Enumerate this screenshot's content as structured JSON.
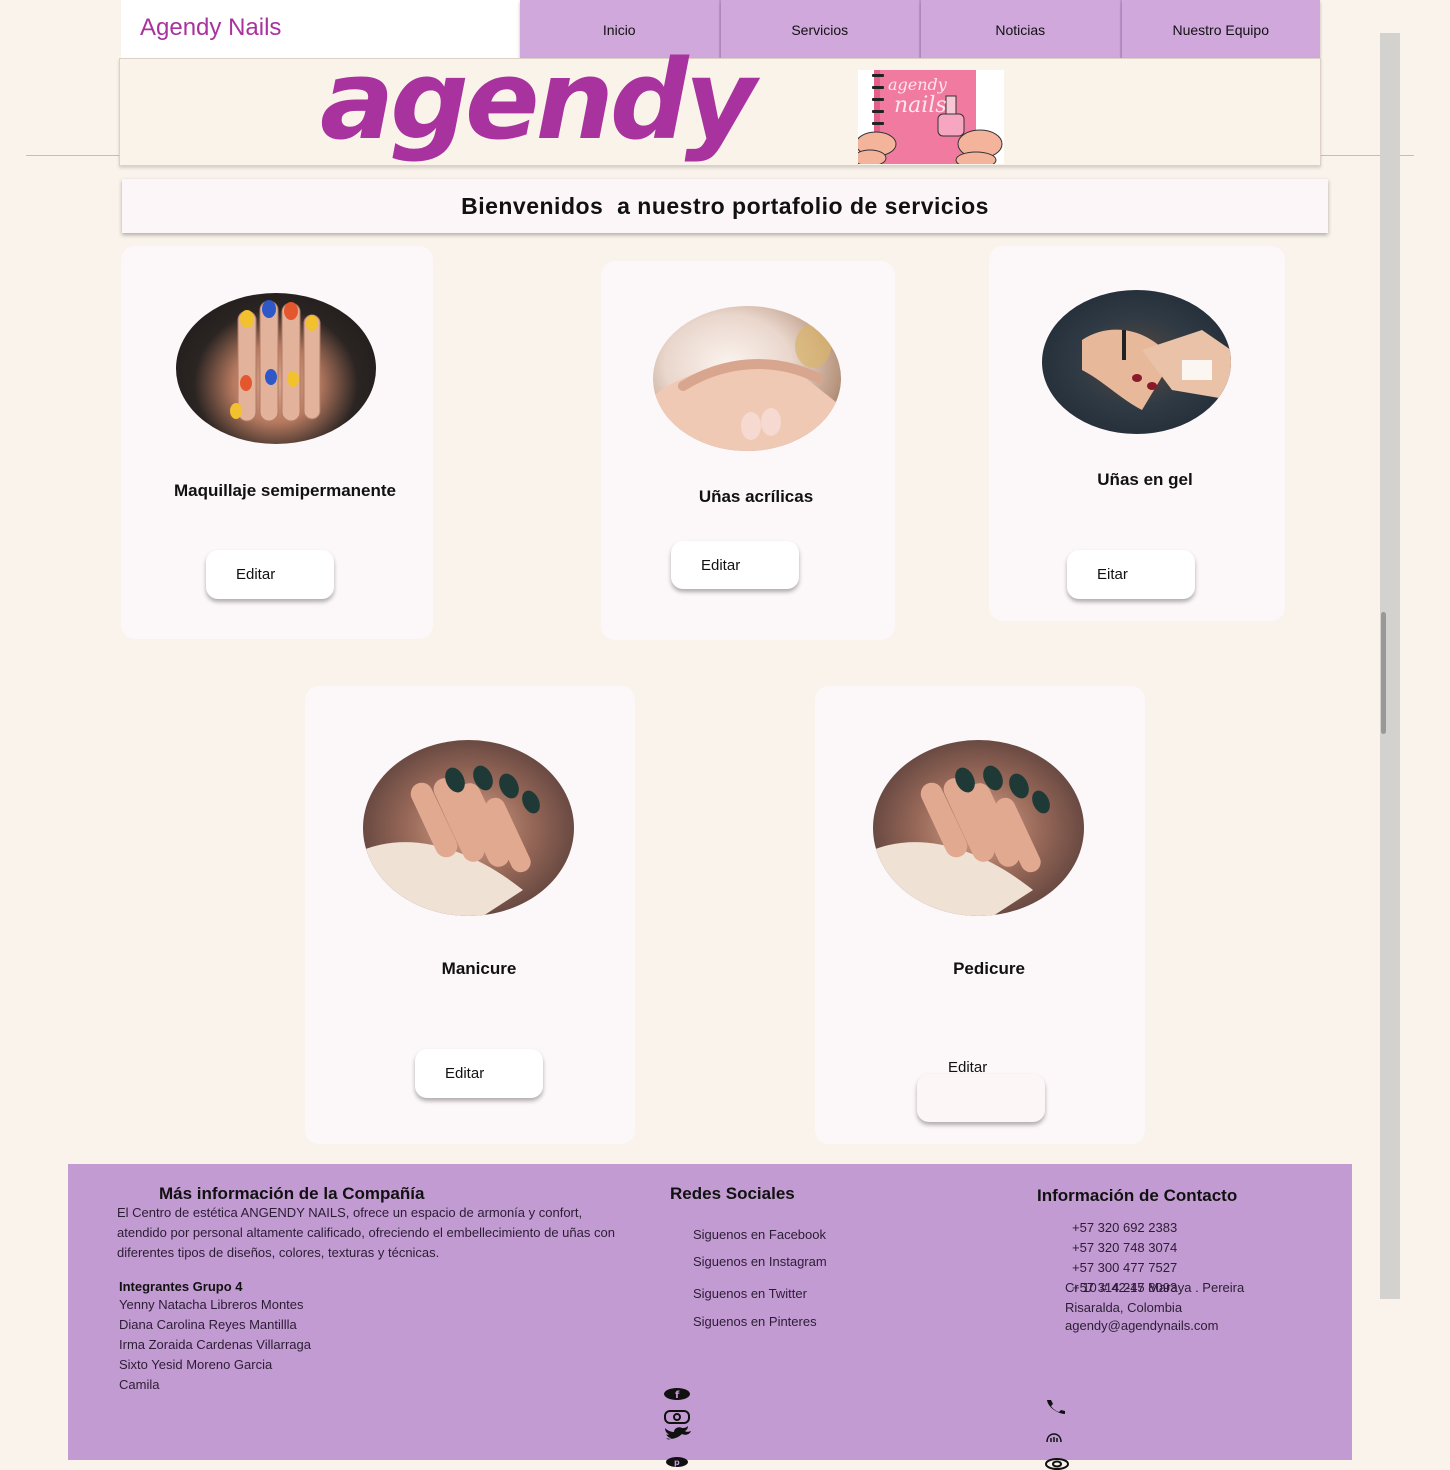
{
  "header": {
    "brand": "Agendy Nails",
    "nav": [
      "Inicio",
      "Servicios",
      "Noticias",
      "Nuestro Equipo"
    ],
    "logo_text": "agendy",
    "notebook_text": [
      "agendy",
      "nails"
    ]
  },
  "welcome": "Bienvenidos  a nuestro portafolio de servicios",
  "services": [
    {
      "title": "Maquillaje semipermanente",
      "button": "Editar"
    },
    {
      "title": "Uñas acrílicas",
      "button": "Editar"
    },
    {
      "title": "Uñas en gel",
      "button": "Eitar"
    },
    {
      "title": "Manicure",
      "button": "Editar"
    },
    {
      "title": "Pedicure",
      "button": "Editar"
    }
  ],
  "footer": {
    "company": {
      "heading": "Más información de la Compañía",
      "description": "El Centro de estética ANGENDY NAILS, ofrece un espacio de armonía y confort, atendido por personal altamente calificado, ofreciendo el embellecimiento de uñas con diferentes tipos de diseños, colores, texturas y técnicas.",
      "members_heading": "Integrantes Grupo 4",
      "members": [
        "Yenny Natacha Libreros Montes",
        "Diana Carolina Reyes Mantillla",
        "Irma Zoraida Cardenas Villarraga",
        "Sixto Yesid Moreno Garcia",
        "Camila"
      ]
    },
    "social": {
      "heading": "Redes Sociales",
      "links": [
        "Siguenos en Facebook",
        "Siguenos en Instagram",
        "Siguenos en Twitter",
        "Siguenos en Pinteres"
      ],
      "icons": [
        "facebook-icon",
        "instagram-icon",
        "twitter-icon",
        "pinterest-icon"
      ]
    },
    "contact": {
      "heading": "Información de Contacto",
      "phones": [
        "+57 320 692 2383",
        "+57 320 748 3074",
        "+57 300 477 7527"
      ],
      "overlap_a": "+57 314 245 8093",
      "overlap_b": "Cr 10 # 42-17 Maraya . Pereira",
      "city": "Risaralda, Colombia",
      "email": "agendy@agendynails.com",
      "icons": [
        "phone-icon",
        "hand-icon",
        "at-icon"
      ]
    }
  },
  "colors": {
    "background": "#faf3ec",
    "nav": "#d0a8dc",
    "brand": "#a8339e",
    "footer": "#c39bd3"
  }
}
